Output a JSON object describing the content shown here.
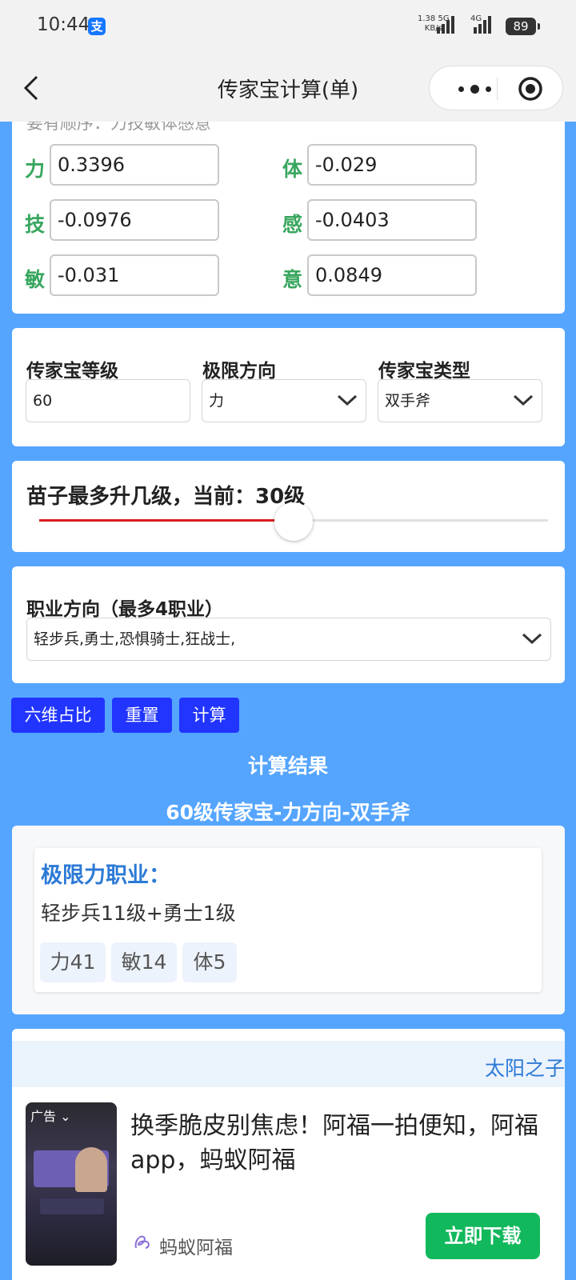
{
  "status_bar": {
    "time": "10:44",
    "app_icon": "支",
    "net_speed": "1.38",
    "net_unit": "KB/s",
    "net_5g": "5G",
    "net_4g": "4G",
    "battery": "89"
  },
  "nav": {
    "title": "传家宝计算(单)",
    "icons": [
      "back-arrow-icon",
      "more-icon",
      "close-target-icon"
    ]
  },
  "attributes": {
    "cut_text": "要有顺序：力技敏体感意",
    "items": [
      {
        "label": "力",
        "value": "0.3396"
      },
      {
        "label": "体",
        "value": "-0.029"
      },
      {
        "label": "技",
        "value": "-0.0976"
      },
      {
        "label": "感",
        "value": "-0.0403"
      },
      {
        "label": "敏",
        "value": "-0.031"
      },
      {
        "label": "意",
        "value": "0.0849"
      }
    ]
  },
  "settings": {
    "level_label": "传家宝等级",
    "level_value": "60",
    "direction_label": "极限方向",
    "direction_value": "力",
    "type_label": "传家宝类型",
    "type_value": "双手斧"
  },
  "slider": {
    "title": "苗子最多升几级，当前：30级",
    "fraction": 0.5
  },
  "jobs": {
    "label": "职业方向（最多4职业）",
    "value": "轻步兵,勇士,恐惧骑士,狂战士,"
  },
  "buttons": {
    "six_dim": "六维占比",
    "reset": "重置",
    "calculate": "计算"
  },
  "result": {
    "heading": "计算结果",
    "subheading": "60级传家宝-力方向-双手斧",
    "card_title": "极限力职业：",
    "card_desc": "轻步兵11级+勇士1级",
    "chips": [
      "力41",
      "敏14",
      "体5"
    ]
  },
  "ad": {
    "header_text": "太阳之子",
    "tag": "广告",
    "text": "换季脆皮别焦虑！阿福一拍便知，阿福app，蚂蚁阿福",
    "brand": "蚂蚁阿福",
    "button": "立即下载",
    "colors": {
      "button": "#12b85c",
      "accent": "#2d7ad6"
    }
  },
  "colors": {
    "background": "#55a5ff",
    "attr_label": "#38a65e",
    "button": "#2135ff",
    "slider_fill": "#d81e1e"
  }
}
